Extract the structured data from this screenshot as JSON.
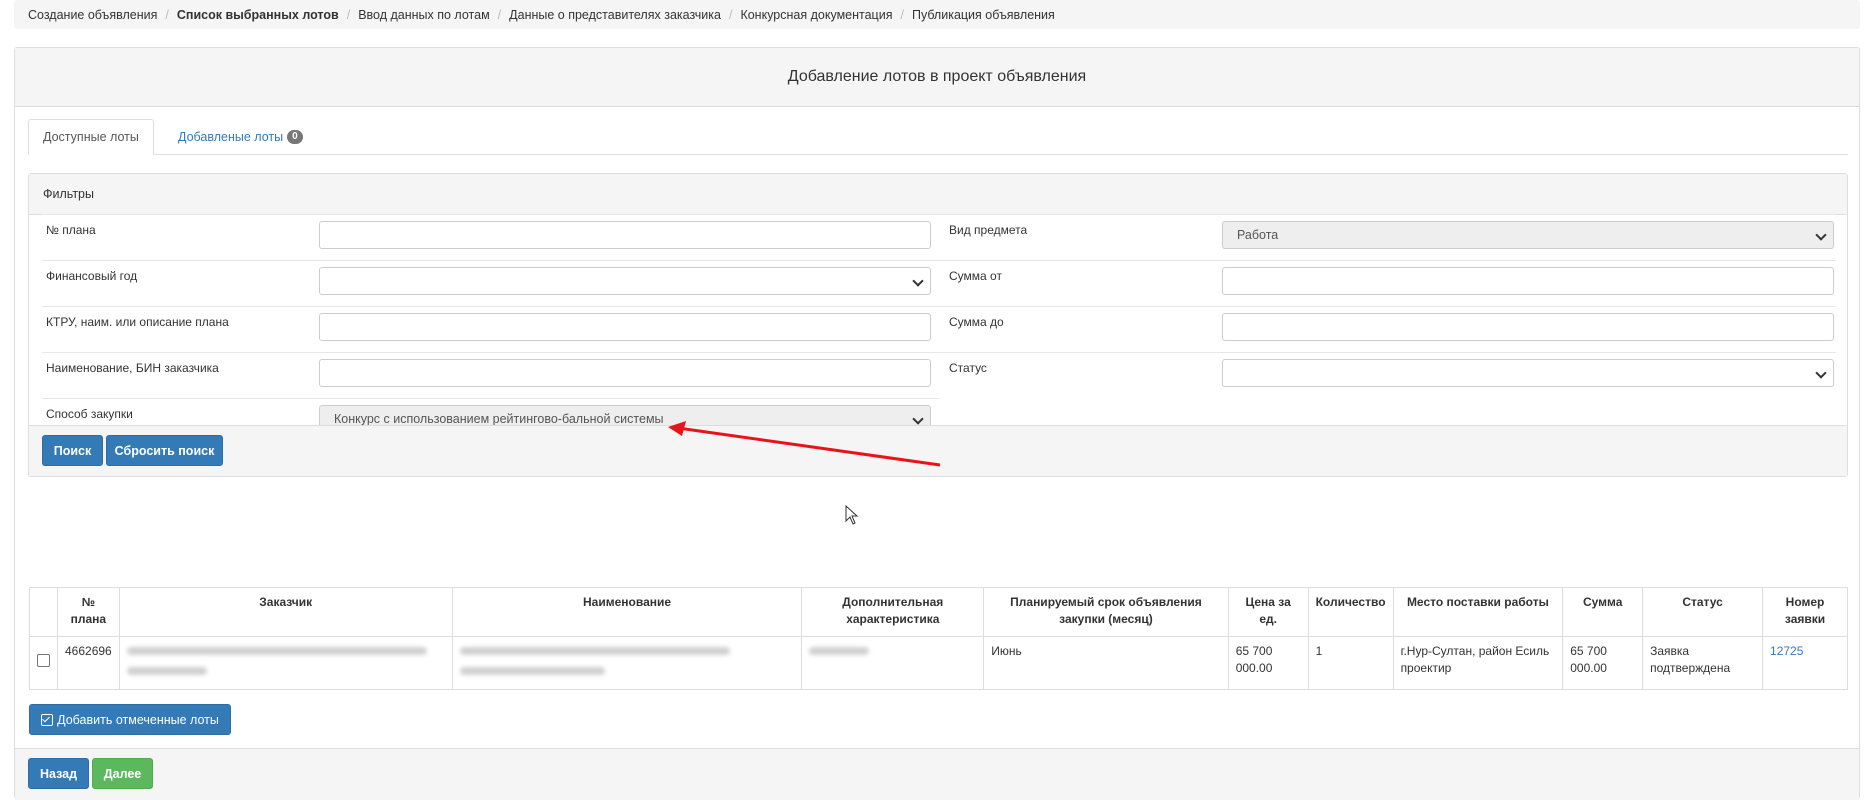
{
  "breadcrumb": {
    "items": [
      "Создание объявления",
      "Список выбранных лотов",
      "Ввод данных по лотам",
      "Данные о представителях заказчика",
      "Конкурсная документация",
      "Публикация объявления"
    ],
    "active_index": 1
  },
  "panel": {
    "title": "Добавление лотов в проект объявления"
  },
  "tabs": {
    "available": "Доступные лоты",
    "added": "Добавленые лоты",
    "added_count": "0"
  },
  "filters": {
    "title": "Фильтры",
    "plan_no_label": "№ плана",
    "plan_no_value": "",
    "subject_type_label": "Вид предмета",
    "subject_type_value": "Работа",
    "fin_year_label": "Финансовый год",
    "fin_year_value": "",
    "sum_from_label": "Сумма от",
    "sum_from_value": "",
    "ktru_label": "КТРУ, наим. или описание плана",
    "ktru_value": "",
    "sum_to_label": "Сумма до",
    "sum_to_value": "",
    "customer_label": "Наименование, БИН заказчика",
    "customer_value": "",
    "status_label": "Статус",
    "status_value": "",
    "method_label": "Способ закупки",
    "method_value": "Конкурс с использованием рейтингово-бальной системы",
    "search_button": "Поиск",
    "reset_button": "Сбросить поиск"
  },
  "table": {
    "headers": {
      "plan_no": "№ плана",
      "customer": "Заказчик",
      "name": "Наименование",
      "extra": "Дополнительная характеристика",
      "period": "Планируемый срок объявления закупки (месяц)",
      "price": "Цена за ед.",
      "qty": "Количество",
      "place": "Место поставки работы",
      "sum": "Сумма",
      "status": "Статус",
      "app_no": "Номер заявки"
    },
    "rows": [
      {
        "plan_no": "4662696",
        "period": "Июнь",
        "price": "65 700 000.00",
        "qty": "1",
        "place": "г.Нур-Султан, район Есиль проектир",
        "sum": "65 700 000.00",
        "status": "Заявка подтверждена",
        "app_no": "12725"
      }
    ]
  },
  "actions": {
    "add_selected": "Добавить отмеченные лоты",
    "back": "Назад",
    "next": "Далее"
  },
  "colors": {
    "primary": "#337ab7",
    "success": "#5cb85c",
    "arrow": "#e8141b"
  }
}
